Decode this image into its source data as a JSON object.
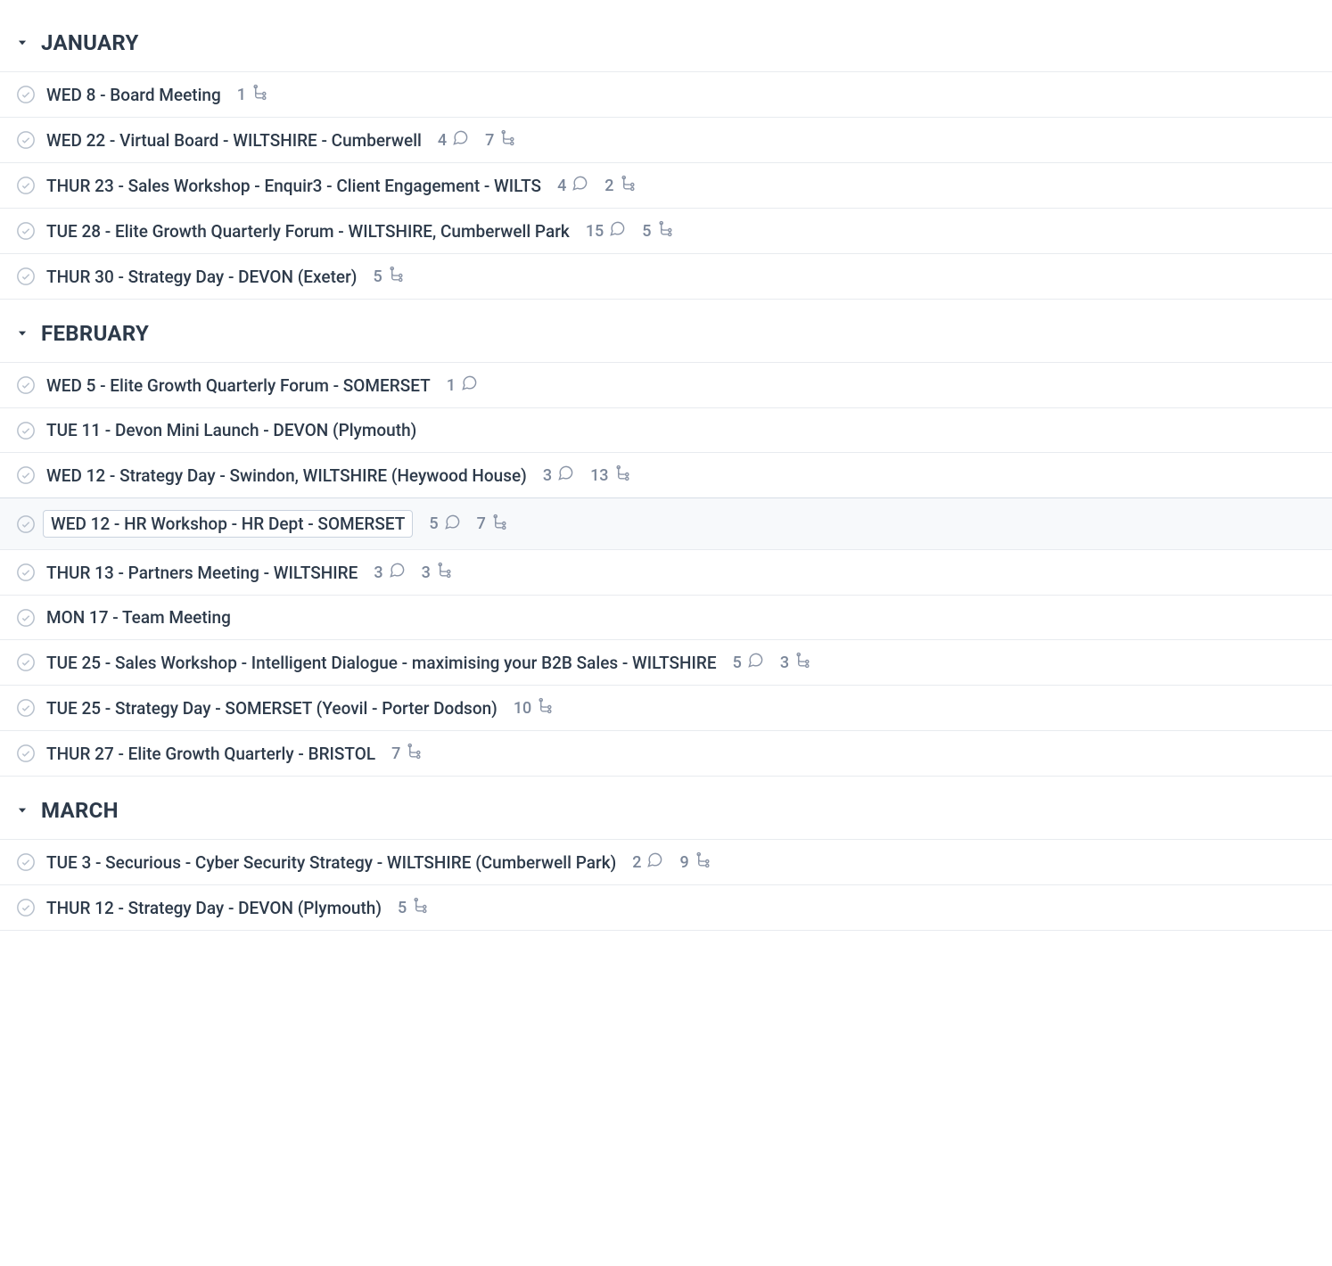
{
  "groups": [
    {
      "name": "JANUARY",
      "items": [
        {
          "title": "WED 8 - Board Meeting",
          "comments": null,
          "subtasks": 1,
          "selected": false
        },
        {
          "title": "WED 22 - Virtual Board - WILTSHIRE - Cumberwell",
          "comments": 4,
          "subtasks": 7,
          "selected": false
        },
        {
          "title": "THUR 23 - Sales Workshop - Enquir3 - Client Engagement - WILTS",
          "comments": 4,
          "subtasks": 2,
          "selected": false
        },
        {
          "title": "TUE 28 - Elite Growth Quarterly Forum - WILTSHIRE, Cumberwell Park",
          "comments": 15,
          "subtasks": 5,
          "selected": false
        },
        {
          "title": "THUR 30 - Strategy Day - DEVON (Exeter)",
          "comments": null,
          "subtasks": 5,
          "selected": false
        }
      ]
    },
    {
      "name": "FEBRUARY",
      "items": [
        {
          "title": "WED 5 - Elite Growth Quarterly Forum - SOMERSET",
          "comments": 1,
          "subtasks": null,
          "selected": false
        },
        {
          "title": "TUE 11 - Devon Mini Launch - DEVON (Plymouth)",
          "comments": null,
          "subtasks": null,
          "selected": false
        },
        {
          "title": "WED 12 - Strategy Day - Swindon, WILTSHIRE (Heywood House)",
          "comments": 3,
          "subtasks": 13,
          "selected": false
        },
        {
          "title": "WED 12 - HR Workshop - HR Dept - SOMERSET",
          "comments": 5,
          "subtasks": 7,
          "selected": true
        },
        {
          "title": "THUR 13 - Partners Meeting - WILTSHIRE",
          "comments": 3,
          "subtasks": 3,
          "selected": false
        },
        {
          "title": "MON 17 - Team Meeting",
          "comments": null,
          "subtasks": null,
          "selected": false
        },
        {
          "title": "TUE 25 - Sales Workshop - Intelligent Dialogue - maximising your B2B Sales - WILTSHIRE",
          "comments": 5,
          "subtasks": 3,
          "selected": false
        },
        {
          "title": "TUE 25 - Strategy Day - SOMERSET (Yeovil - Porter Dodson)",
          "comments": null,
          "subtasks": 10,
          "selected": false
        },
        {
          "title": "THUR 27 - Elite Growth Quarterly - BRISTOL",
          "comments": null,
          "subtasks": 7,
          "selected": false
        }
      ]
    },
    {
      "name": "MARCH",
      "items": [
        {
          "title": "TUE 3 - Securious - Cyber Security Strategy - WILTSHIRE (Cumberwell Park)",
          "comments": 2,
          "subtasks": 9,
          "selected": false
        },
        {
          "title": "THUR 12 - Strategy Day - DEVON (Plymouth)",
          "comments": null,
          "subtasks": 5,
          "selected": false
        }
      ]
    }
  ]
}
